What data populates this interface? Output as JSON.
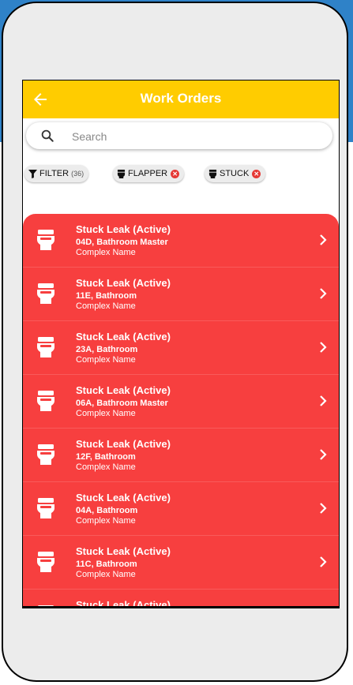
{
  "appbar": {
    "title": "Work Orders",
    "back_icon": "arrow-left-icon",
    "color": "#ffcc00"
  },
  "search": {
    "placeholder": "Search",
    "value": ""
  },
  "filters": {
    "filter_label": "FILTER",
    "filter_count": "(36)",
    "chips": [
      {
        "label": "FLAPPER",
        "icon": "toilet-icon"
      },
      {
        "label": "STUCK",
        "icon": "toilet-icon"
      }
    ]
  },
  "list": {
    "color": "#f73f3f",
    "items": [
      {
        "title": "Stuck Leak (Active)",
        "unit": "04D, Bathroom Master",
        "complex": "Complex Name"
      },
      {
        "title": "Stuck Leak (Active)",
        "unit": "11E, Bathroom",
        "complex": "Complex Name"
      },
      {
        "title": "Stuck Leak (Active)",
        "unit": "23A, Bathroom",
        "complex": "Complex Name"
      },
      {
        "title": "Stuck Leak (Active)",
        "unit": "06A, Bathroom Master",
        "complex": "Complex Name"
      },
      {
        "title": "Stuck Leak (Active)",
        "unit": "12F, Bathroom",
        "complex": "Complex Name"
      },
      {
        "title": "Stuck Leak (Active)",
        "unit": "04A, Bathroom",
        "complex": "Complex Name"
      },
      {
        "title": "Stuck Leak (Active)",
        "unit": "11C, Bathroom",
        "complex": "Complex Name"
      },
      {
        "title": "Stuck Leak (Active)",
        "unit": "",
        "complex": ""
      }
    ]
  }
}
